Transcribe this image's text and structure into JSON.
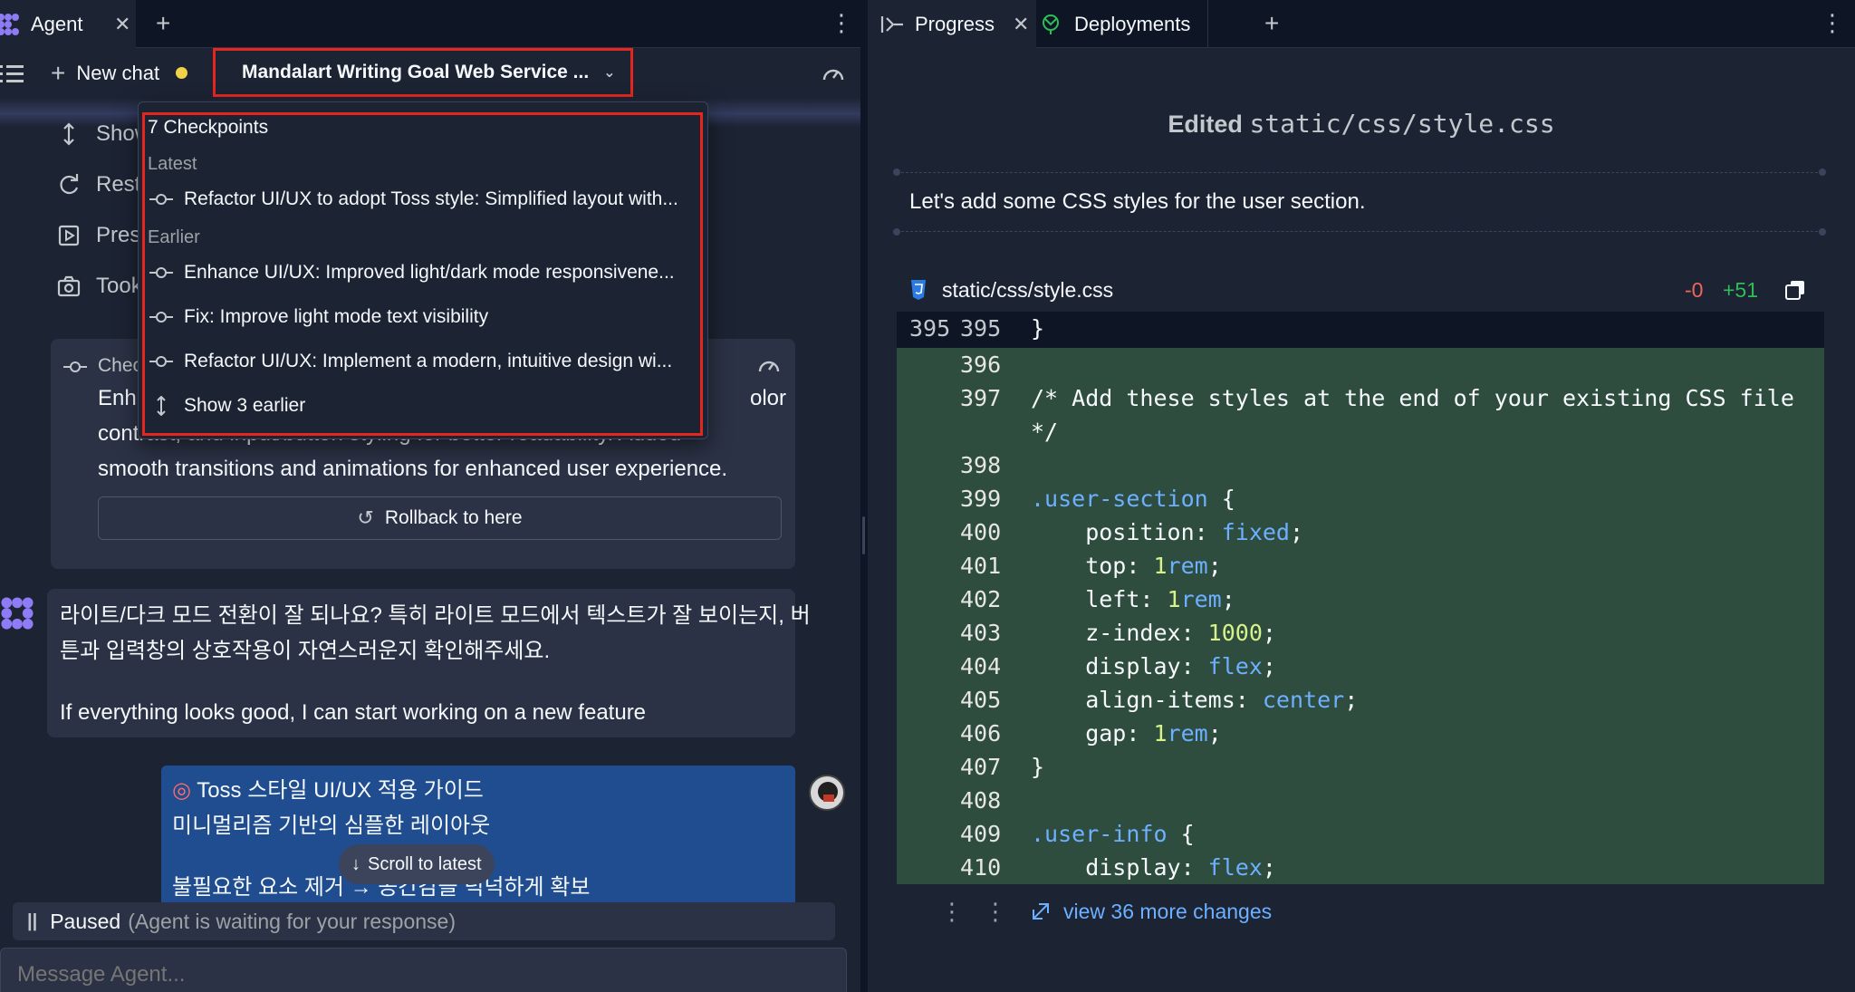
{
  "agent_pane": {
    "tab_label": "Agent",
    "new_chat_label": "New chat",
    "chat_title": "Mandalart Writing Goal Web Service ...",
    "actions": [
      "Show",
      "Rest",
      "Pres",
      "Took"
    ],
    "checkpoint_card": {
      "label": "Chec",
      "text_line1_start": "Enh",
      "text_line1_end": "olor",
      "text_line2": "contrast, and input/button styling for better readability. Added",
      "text_line3": "smooth transitions and animations for enhanced user experience.",
      "rollback_label": "Rollback to here"
    },
    "agent_message": {
      "line1": "라이트/다크 모드 전환이 잘 되나요? 특히 라이트 모드에서 텍스트가 잘 보이는지, 버",
      "line2": "튼과 입력창의 상호작용이 자연스러운지 확인해주세요.",
      "line3": "If everything looks good, I can start working on a new feature"
    },
    "user_message": {
      "line1": "Toss 스타일 UI/UX 적용 가이드",
      "line2": "미니멀리즘 기반의 심플한 레이아웃",
      "line3": "불필요한 요소 제거 → 공간감을 넉넉하게 확보"
    },
    "scroll_to_latest": "Scroll to latest",
    "paused_label": "Paused",
    "paused_detail": "(Agent is waiting for your response)",
    "composer_placeholder": "Message Agent..."
  },
  "checkpoints_dropdown": {
    "title": "7 Checkpoints",
    "latest_label": "Latest",
    "latest": [
      "Refactor UI/UX to adopt Toss style: Simplified layout with..."
    ],
    "earlier_label": "Earlier",
    "earlier": [
      "Enhance UI/UX: Improved light/dark mode responsivene...",
      "Fix: Improve light mode text visibility",
      "Refactor UI/UX: Implement a modern, intuitive design wi..."
    ],
    "show_earlier": "Show 3 earlier"
  },
  "progress_pane": {
    "tabs": [
      "Progress",
      "Deployments"
    ],
    "edited_prefix": "Edited",
    "edited_file": "static/css/style.css",
    "note": "Let's add some CSS styles for the user section.",
    "diff": {
      "filename": "static/css/style.css",
      "removed": "-0",
      "added": "+51",
      "context_old": "395",
      "context_new": "395",
      "context_code": "}",
      "lines": [
        {
          "n": "396",
          "code": ""
        },
        {
          "n": "397",
          "code": "/* Add these styles at the end of your existing CSS file"
        },
        {
          "n": "",
          "code": "*/"
        },
        {
          "n": "398",
          "code": ""
        },
        {
          "n": "399",
          "code": ".user-section {"
        },
        {
          "n": "400",
          "code": "    position: fixed;"
        },
        {
          "n": "401",
          "code": "    top: 1rem;"
        },
        {
          "n": "402",
          "code": "    left: 1rem;"
        },
        {
          "n": "403",
          "code": "    z-index: 1000;"
        },
        {
          "n": "404",
          "code": "    display: flex;"
        },
        {
          "n": "405",
          "code": "    align-items: center;"
        },
        {
          "n": "406",
          "code": "    gap: 1rem;"
        },
        {
          "n": "407",
          "code": "}"
        },
        {
          "n": "408",
          "code": ""
        },
        {
          "n": "409",
          "code": ".user-info {"
        },
        {
          "n": "410",
          "code": "    display: flex;"
        }
      ],
      "more_changes": "view 36 more changes"
    }
  },
  "colors": {
    "accent_red": "#e5261f",
    "status_yellow": "#f2d249",
    "diff_added_bg": "#2f4d3f",
    "link_blue": "#6cb0ff"
  }
}
